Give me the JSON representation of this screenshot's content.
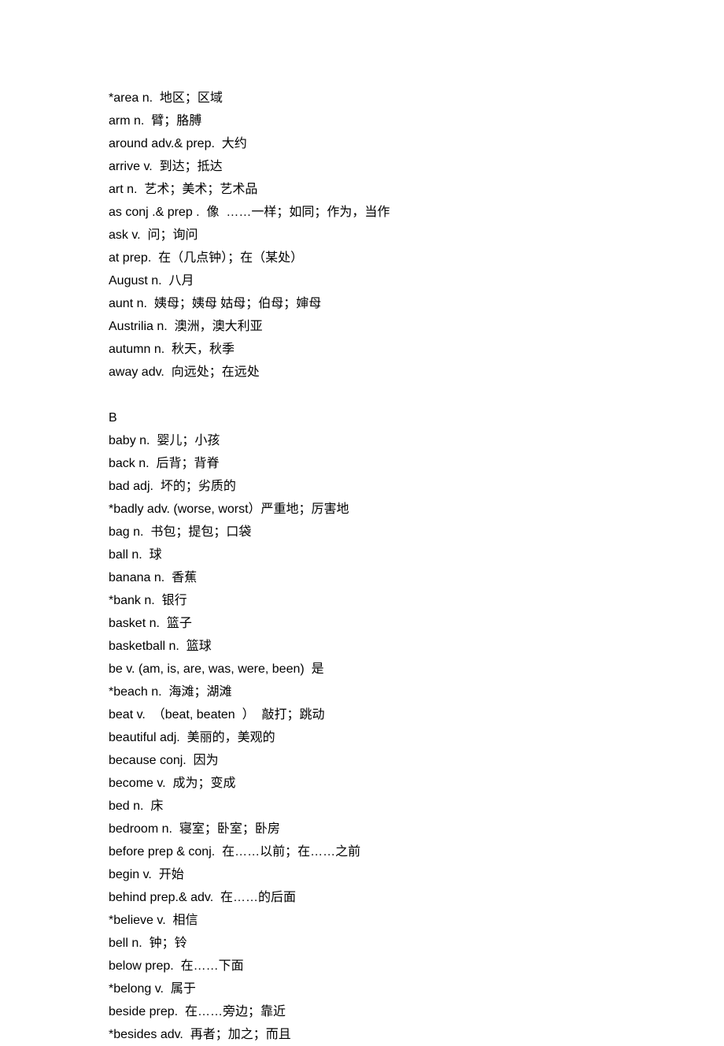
{
  "entries_a": [
    "*area n.  地区；区域",
    "arm n.  臂；胳膊",
    "around adv.& prep.  大约",
    "arrive v.  到达；抵达",
    "art n.  艺术；美术；艺术品",
    "as conj .& prep .  像  ……一样；如同；作为，当作",
    "ask v.  问；询问",
    "at prep.  在（几点钟）；在（某处）",
    "August n.  八月",
    "aunt n.  姨母；姨母 姑母；伯母；婶母",
    "Austrilia n.  澳洲，澳大利亚",
    "autumn n.  秋天，秋季",
    "away adv.  向远处；在远处"
  ],
  "section_b_header": "B",
  "entries_b": [
    "baby n.  婴儿；小孩",
    "back n.  后背；背脊",
    "bad adj.  坏的；劣质的",
    "*badly adv. (worse, worst）严重地；厉害地",
    "bag n.  书包；提包；口袋",
    "ball n.  球",
    "banana n.  香蕉",
    "*bank n.  银行",
    "basket n.  篮子",
    "basketball n.  篮球",
    "be v. (am, is, are, was, were, been)  是",
    "*beach n.  海滩；湖滩",
    "beat v.  （beat, beaten  ）  敲打；跳动",
    "beautiful adj.  美丽的，美观的",
    "because conj.  因为",
    "become v.  成为；变成",
    "bed n.  床",
    "bedroom n.  寝室；卧室；卧房",
    "before prep & conj.  在……以前；在……之前",
    "begin v.  开始",
    "behind prep.& adv.  在……的后面",
    "*believe v.  相信",
    "bell n.  钟；铃",
    "below prep.  在……下面",
    "*belong v.  属于",
    "beside prep.  在……旁边；靠近",
    "*besides adv.  再者；加之；而且"
  ]
}
